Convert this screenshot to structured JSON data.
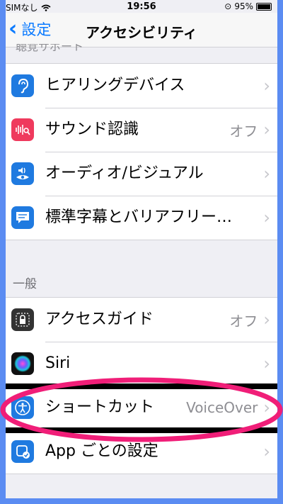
{
  "status_bar": {
    "carrier": "SIMなし",
    "time": "19:56",
    "battery": "95%"
  },
  "nav": {
    "back_label": "設定",
    "title": "アクセシビリティ"
  },
  "sections": {
    "hearing_header": "聴覚サポート",
    "hearing_items": [
      {
        "label": "ヒアリングデバイス",
        "value": "",
        "icon": "ear-icon",
        "color": "#1f7ae0"
      },
      {
        "label": "サウンド認識",
        "value": "オフ",
        "icon": "sound-recognition-icon",
        "color": "#ef3a5d"
      },
      {
        "label": "オーディオ/ビジュアル",
        "value": "",
        "icon": "audio-visual-icon",
        "color": "#1f7ae0"
      },
      {
        "label": "標準字幕とバリアフリー…",
        "value": "",
        "icon": "subtitles-icon",
        "color": "#1f7ae0"
      }
    ],
    "general_header": "一般",
    "general_items": [
      {
        "label": "アクセスガイド",
        "value": "オフ",
        "icon": "lock-icon",
        "color": "#333333"
      },
      {
        "label": "Siri",
        "value": "",
        "icon": "siri-icon",
        "color": "#111111"
      },
      {
        "label": "ショートカット",
        "value": "VoiceOver",
        "icon": "accessibility-icon",
        "color": "#1f7ae0"
      },
      {
        "label": "App ごとの設定",
        "value": "",
        "icon": "app-settings-icon",
        "color": "#1f7ae0"
      }
    ]
  },
  "annotation_color": "#f01e78"
}
